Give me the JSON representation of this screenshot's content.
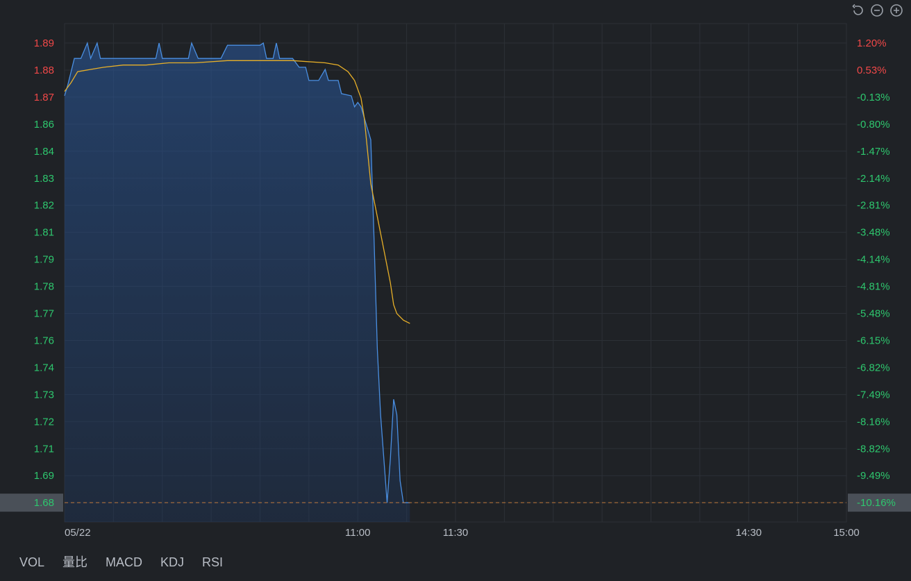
{
  "toolbar": {
    "icons": [
      "reset-icon",
      "zoom-out-icon",
      "zoom-in-icon"
    ]
  },
  "chart_data": {
    "type": "line",
    "date_label": "05/22",
    "left_axis_ticks": [
      "1.89",
      "1.88",
      "1.87",
      "1.86",
      "1.84",
      "1.83",
      "1.82",
      "1.81",
      "1.79",
      "1.78",
      "1.77",
      "1.76",
      "1.74",
      "1.73",
      "1.72",
      "1.71",
      "1.69",
      "1.68"
    ],
    "right_axis_ticks": [
      "1.20%",
      "0.53%",
      "-0.13%",
      "-0.80%",
      "-1.47%",
      "-2.14%",
      "-2.81%",
      "-3.48%",
      "-4.14%",
      "-4.81%",
      "-5.48%",
      "-6.15%",
      "-6.82%",
      "-7.49%",
      "-8.16%",
      "-8.82%",
      "-9.49%",
      "-10.16%"
    ],
    "x_tick_labels": [
      {
        "time": "11:00",
        "minute": 90
      },
      {
        "time": "11:30",
        "minute": 120
      },
      {
        "time": "14:30",
        "minute": 210
      },
      {
        "time": "15:00",
        "minute": 240
      }
    ],
    "xlim": [
      0,
      240
    ],
    "current_price_label": "1.68",
    "current_pct_label": "-10.16%",
    "reference_price": 1.867,
    "colors": {
      "up": "#f04848",
      "down": "#2ec76e",
      "price_line": "#4a8fe2",
      "avg_line": "#e8b028",
      "grid": "#2c3036",
      "current_line": "#c07a3c"
    },
    "series": [
      {
        "type": "price",
        "points": [
          [
            0,
            1.865
          ],
          [
            1,
            1.87
          ],
          [
            3,
            1.882
          ],
          [
            5,
            1.882
          ],
          [
            7,
            1.889
          ],
          [
            8,
            1.882
          ],
          [
            10,
            1.889
          ],
          [
            11,
            1.882
          ],
          [
            14,
            1.882
          ],
          [
            20,
            1.882
          ],
          [
            28,
            1.882
          ],
          [
            29,
            1.889
          ],
          [
            30,
            1.882
          ],
          [
            33,
            1.882
          ],
          [
            38,
            1.882
          ],
          [
            39,
            1.889
          ],
          [
            41,
            1.882
          ],
          [
            48,
            1.882
          ],
          [
            50,
            1.888
          ],
          [
            60,
            1.888
          ],
          [
            61,
            1.889
          ],
          [
            62,
            1.882
          ],
          [
            64,
            1.882
          ],
          [
            65,
            1.889
          ],
          [
            66,
            1.882
          ],
          [
            70,
            1.882
          ],
          [
            72,
            1.878
          ],
          [
            74,
            1.878
          ],
          [
            75,
            1.872
          ],
          [
            78,
            1.872
          ],
          [
            80,
            1.877
          ],
          [
            81,
            1.872
          ],
          [
            84,
            1.872
          ],
          [
            85,
            1.866
          ],
          [
            88,
            1.865
          ],
          [
            89,
            1.86
          ],
          [
            90,
            1.862
          ],
          [
            91,
            1.86
          ],
          [
            92,
            1.855
          ],
          [
            94,
            1.845
          ],
          [
            95,
            1.8
          ],
          [
            96,
            1.75
          ],
          [
            97,
            1.72
          ],
          [
            98,
            1.7
          ],
          [
            99,
            1.68
          ],
          [
            100,
            1.7
          ],
          [
            101,
            1.727
          ],
          [
            102,
            1.72
          ],
          [
            103,
            1.69
          ],
          [
            104,
            1.68
          ],
          [
            106,
            1.68
          ]
        ]
      },
      {
        "type": "average",
        "points": [
          [
            0,
            1.867
          ],
          [
            2,
            1.871
          ],
          [
            4,
            1.876
          ],
          [
            8,
            1.877
          ],
          [
            12,
            1.878
          ],
          [
            18,
            1.879
          ],
          [
            25,
            1.879
          ],
          [
            32,
            1.88
          ],
          [
            40,
            1.88
          ],
          [
            50,
            1.881
          ],
          [
            60,
            1.881
          ],
          [
            70,
            1.881
          ],
          [
            80,
            1.88
          ],
          [
            84,
            1.879
          ],
          [
            87,
            1.876
          ],
          [
            89,
            1.872
          ],
          [
            91,
            1.864
          ],
          [
            92,
            1.855
          ],
          [
            93,
            1.84
          ],
          [
            94,
            1.825
          ],
          [
            96,
            1.81
          ],
          [
            98,
            1.795
          ],
          [
            100,
            1.78
          ],
          [
            101,
            1.77
          ],
          [
            102,
            1.766
          ],
          [
            104,
            1.763
          ],
          [
            106,
            1.7615
          ]
        ]
      }
    ]
  },
  "tabs": [
    "VOL",
    "量比",
    "MACD",
    "KDJ",
    "RSI"
  ]
}
